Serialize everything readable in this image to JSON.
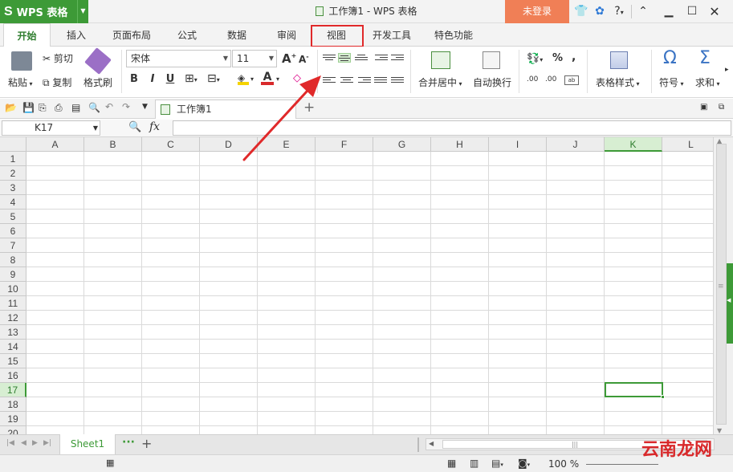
{
  "app": {
    "logo": "S",
    "name": "WPS 表格",
    "doc_title": "工作簿1 - WPS 表格",
    "login": "未登录",
    "help": "?"
  },
  "tabs": [
    {
      "label": "开始",
      "active": true
    },
    {
      "label": "插入"
    },
    {
      "label": "页面布局"
    },
    {
      "label": "公式"
    },
    {
      "label": "数据"
    },
    {
      "label": "审阅"
    },
    {
      "label": "视图",
      "highlighted": true
    },
    {
      "label": "开发工具"
    },
    {
      "label": "特色功能"
    }
  ],
  "ribbon": {
    "paste": "粘贴",
    "cut": "剪切",
    "copy": "复制",
    "format_painter": "格式刷",
    "font_name": "宋体",
    "font_size": "11",
    "bold": "B",
    "italic": "I",
    "underline": "U",
    "merge_center": "合并居中",
    "wrap_text": "自动换行",
    "table_style": "表格样式",
    "symbol": "符号",
    "sum": "求和",
    "percent": "%",
    "comma": ","
  },
  "doc_tab": {
    "label": "工作簿1"
  },
  "formula_bar": {
    "name_box": "K17",
    "fx": "fx",
    "content": ""
  },
  "grid": {
    "columns": [
      "A",
      "B",
      "C",
      "D",
      "E",
      "F",
      "G",
      "H",
      "I",
      "J",
      "K",
      "L"
    ],
    "selected_column": "K",
    "rows": [
      "1",
      "2",
      "3",
      "4",
      "5",
      "6",
      "7",
      "8",
      "9",
      "10",
      "11",
      "12",
      "13",
      "14",
      "15",
      "16",
      "17",
      "18",
      "19",
      "20"
    ],
    "selected_row": "17",
    "active_cell": "K17"
  },
  "sheets": [
    {
      "label": "Sheet1",
      "active": true
    }
  ],
  "status": {
    "zoom": "100 %"
  },
  "watermark": "云南龙网",
  "colors": {
    "accent": "#3d9a37",
    "login": "#f07f56",
    "highlight_box": "#e0292a",
    "arrow": "#e0292a"
  }
}
